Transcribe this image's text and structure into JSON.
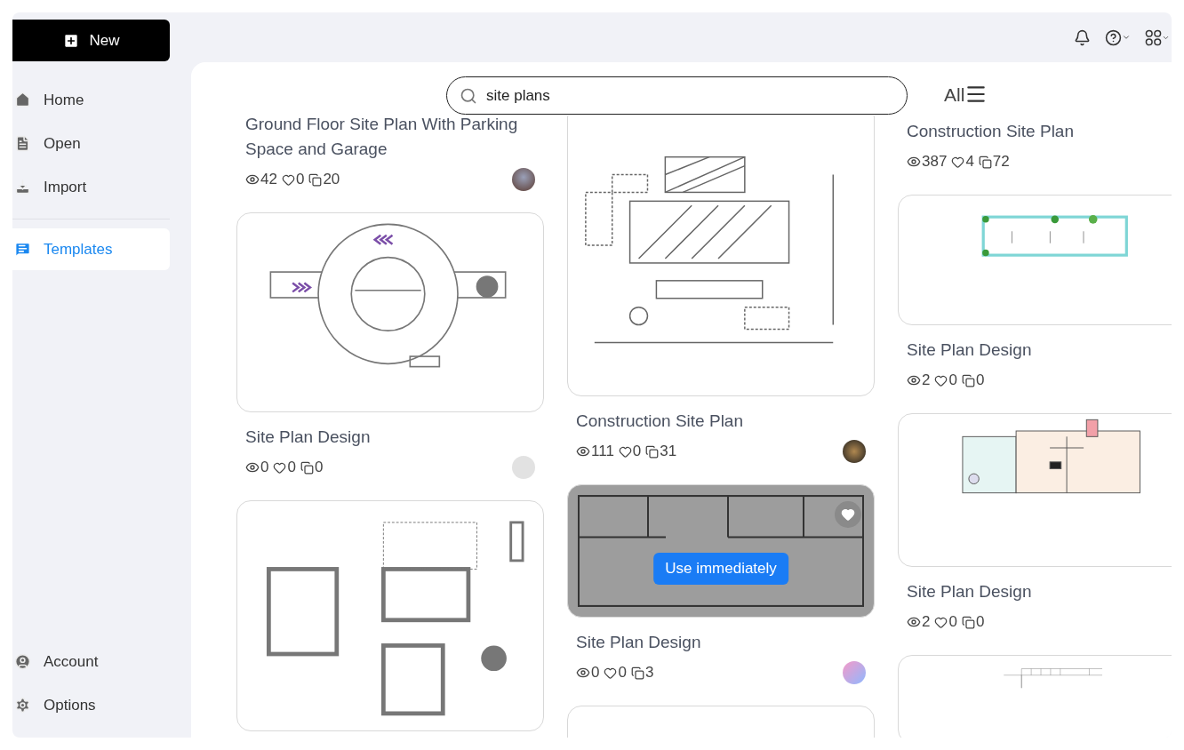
{
  "new_button": {
    "label": "New"
  },
  "sidebar": {
    "items": [
      {
        "label": "Home",
        "kind": "home",
        "selected": false
      },
      {
        "label": "Open",
        "kind": "open",
        "selected": false
      },
      {
        "label": "Import",
        "kind": "import",
        "selected": false
      },
      {
        "label": "Templates",
        "kind": "templates",
        "selected": true
      }
    ],
    "bottom_items": [
      {
        "label": "Account",
        "kind": "account"
      },
      {
        "label": "Options",
        "kind": "options"
      }
    ]
  },
  "search": {
    "value": "site plans"
  },
  "filter": {
    "label": "All"
  },
  "columns": [
    {
      "cards": [
        {
          "title": "Ground Floor Site Plan With Parking Space and Garage",
          "views": "42",
          "likes": "0",
          "copies": "20",
          "avatar": {
            "kind": "photo"
          }
        },
        {
          "thumbnail": {
            "kind": "ring"
          },
          "title": "Site Plan Design",
          "views": "0",
          "likes": "0",
          "copies": "0",
          "avatar": {
            "kind": "placeholder"
          }
        },
        {
          "thumbnail": {
            "kind": "house"
          }
        }
      ]
    },
    {
      "cards": [
        {
          "thumbnail": {
            "kind": "site"
          },
          "title": "Construction Site Plan",
          "views": "111",
          "likes": "0",
          "copies": "31",
          "avatar": {
            "kind": "dark"
          }
        },
        {
          "thumbnail": {
            "kind": "office"
          },
          "hovered": true,
          "action": "Use immediately",
          "title": "Site Plan Design",
          "views": "0",
          "likes": "0",
          "copies": "3",
          "avatar": {
            "kind": "gradient"
          }
        },
        {
          "thumbnail": {
            "kind": "blank"
          }
        }
      ]
    },
    {
      "cards": [
        {
          "title": "Construction Site Plan",
          "views": "387",
          "likes": "4",
          "copies": "72"
        },
        {
          "thumbnail": {
            "kind": "exhibit"
          },
          "title": "Site Plan Design",
          "views": "2",
          "likes": "0",
          "copies": "0"
        },
        {
          "thumbnail": {
            "kind": "cafe"
          },
          "title": "Site Plan Design",
          "views": "2",
          "likes": "0",
          "copies": "0"
        },
        {
          "thumbnail": {
            "kind": "table"
          }
        }
      ]
    }
  ]
}
